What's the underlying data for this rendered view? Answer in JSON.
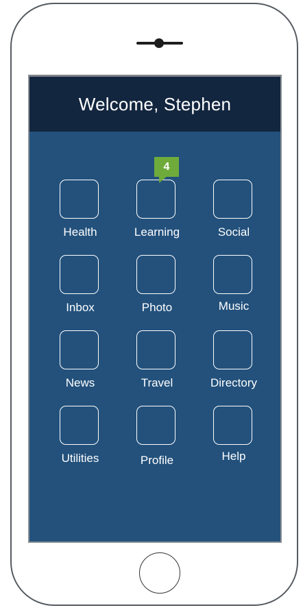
{
  "header": {
    "title": "Welcome, Stephen"
  },
  "apps": [
    {
      "label": "Health"
    },
    {
      "label": "Learning",
      "badge": "4"
    },
    {
      "label": "Social"
    },
    {
      "label": "Inbox"
    },
    {
      "label": "Photo"
    },
    {
      "label": "Music"
    },
    {
      "label": "News"
    },
    {
      "label": "Travel"
    },
    {
      "label": "Directory"
    },
    {
      "label": "Utilities"
    },
    {
      "label": "Profile"
    },
    {
      "label": "Help"
    }
  ],
  "colors": {
    "screen_bg": "#23517c",
    "title_bg": "#13263f",
    "badge": "#6fab3b"
  }
}
